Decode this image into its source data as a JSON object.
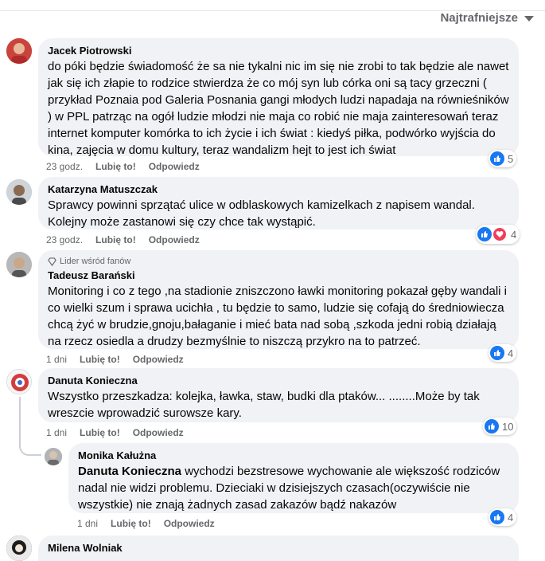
{
  "sort": {
    "label": "Najtrafniejsze"
  },
  "actions": {
    "like": "Lubię to!",
    "reply": "Odpowiedz"
  },
  "comments": [
    {
      "author": "Jacek Piotrowski",
      "text": "do póki będzie świadomość że sa nie tykalni nic im się nie zrobi to tak będzie ale nawet jak się ich złapie to rodzice stwierdza że co mój syn lub córka oni są tacy grzeczni ( przykład Poznaia pod Galeria Posnania gangi młodych ludzi napadaja na równieśników ) w PPL patrząc na ogół ludzie młodzi nie maja co robić nie maja zainteresowań teraz internet komputer komórka to ich życie i ich świat : kiedyś piłka, podwórko wyjścia do kina, zajęcia w domu kultury, teraz wandalizm hejt to jest ich świat",
      "time": "23 godz.",
      "reactions": "5"
    },
    {
      "author": "Katarzyna Matuszczak",
      "text": "Sprawcy powinni sprzątać ulice w odblaskowych kamizelkach z napisem wandal. Kolejny może zastanowi się czy chce tak wystąpić.",
      "time": "23 godz.",
      "reactions": "4"
    },
    {
      "badge": "Lider wśród fanów",
      "author": "Tadeusz Barański",
      "text": "Monitoring i co z tego ,na stadionie zniszczono ławki monitoring pokazał gęby wandali i co wielki szum i sprawa ucichła , tu będzie to samo, ludzie się cofają do średniowiecza chcą żyć w brudzie,gnoju,bałaganie i mieć bata nad sobą ,szkoda jedni robią działają na rzecz osiedla a drudzy bezmyślnie to niszczą przykro na to patrzeć.",
      "time": "1 dni",
      "reactions": "4"
    },
    {
      "author": "Danuta Konieczna",
      "text": "Wszystko przeszkadza: kolejka, ławka, staw, budki dla ptaków... ........Może by tak wreszcie wprowadzić surowsze kary.",
      "time": "1 dni",
      "reactions": "10"
    },
    {
      "author": "Monika Kałużna",
      "mention": "Danuta Konieczna",
      "text": " wychodzi bezstresowe wychowanie ale większość rodziców nadal nie widzi problemu. Dzieciaki w dzisiejszych czasach(oczywiście nie wszystkie) nie znają żadnych zasad zakazów bądź nakazów",
      "time": "1 dni",
      "reactions": "4"
    },
    {
      "author": "Milena Wolniak"
    }
  ]
}
